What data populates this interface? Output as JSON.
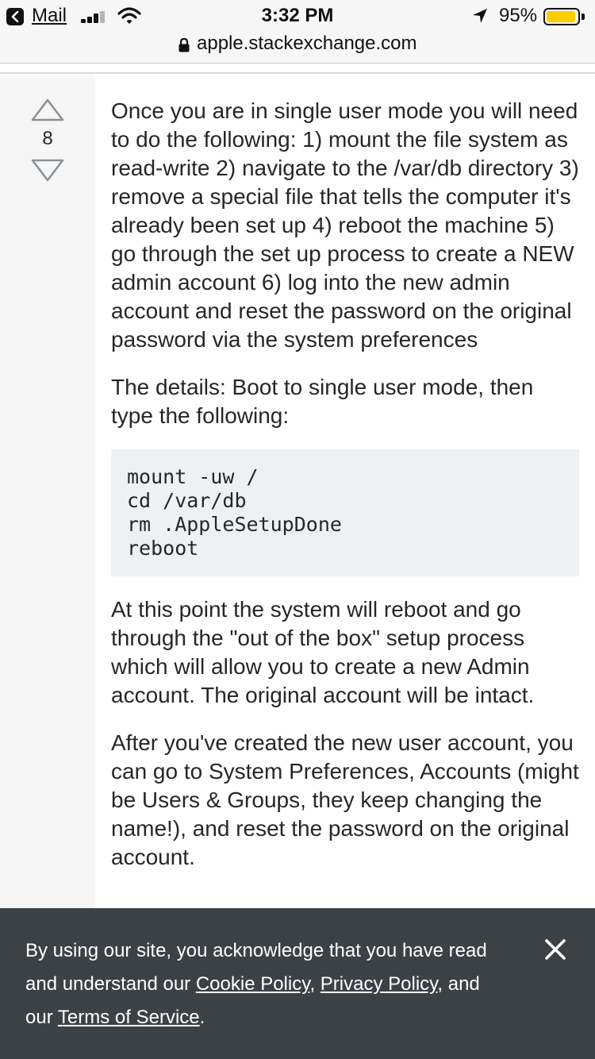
{
  "status_bar": {
    "back_app": "Mail",
    "time": "3:32 PM",
    "battery_percent": "95%",
    "battery_level": 0.95,
    "signal_bars_active": 3,
    "signal_bars_total": 4
  },
  "browser": {
    "url": "apple.stackexchange.com"
  },
  "answer": {
    "vote_count": "8",
    "paragraphs": [
      "Once you are in single user mode you will need to do the following: 1) mount the file system as read-write 2) navigate to the /var/db directory 3) remove a special file that tells the computer it's already been set up 4) reboot the machine 5) go through the set up process to create a NEW admin account 6) log into the new admin account and reset the password on the original password via the system preferences",
      "The details: Boot to single user mode, then type the following:"
    ],
    "code_lines": [
      "mount -uw /",
      "cd /var/db",
      "rm .AppleSetupDone",
      "reboot"
    ],
    "paragraphs_after": [
      "At this point the system will reboot and go through the \"out of the box\" setup process which will allow you to create a new Admin account. The original account will be intact.",
      "After you've created the new user account, you can go to System Preferences, Accounts (might be Users & Groups, they keep changing the name!), and reset the password on the original account."
    ]
  },
  "cookie_banner": {
    "text_before": "By using our site, you acknowledge that you have read and understand our ",
    "cookie_policy": "Cookie Policy",
    "separator": ", ",
    "privacy_policy": "Privacy Policy",
    "text_middle": ", and our ",
    "terms": "Terms of Service",
    "text_end": "."
  },
  "colors": {
    "battery": "#ffcc00",
    "banner_bg": "#3c4146",
    "vote_col_bg": "#f6f6f6",
    "code_bg": "#eff0f1"
  },
  "icons": {
    "back": "chevron-left-icon",
    "wifi": "wifi-icon",
    "location": "location-arrow-icon",
    "lock": "lock-icon",
    "vote_up": "triangle-up-icon",
    "vote_down": "triangle-down-icon",
    "close": "close-icon"
  }
}
